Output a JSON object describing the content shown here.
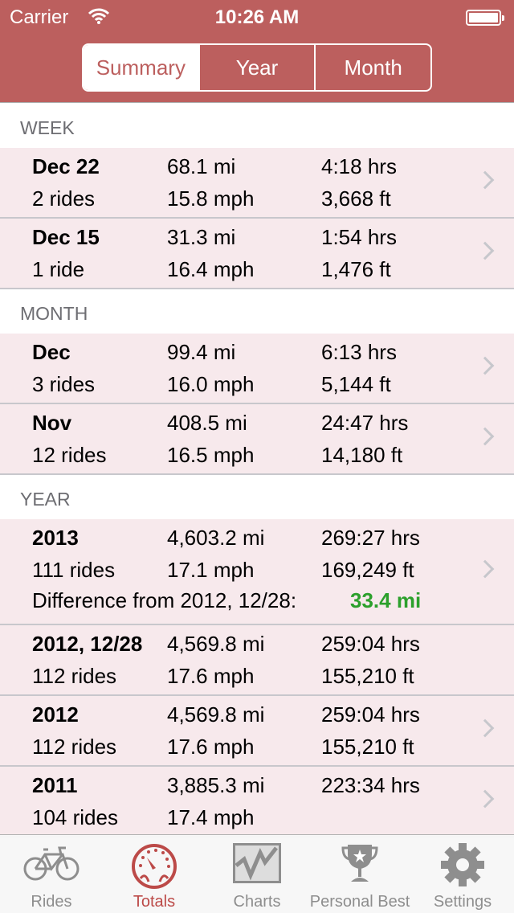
{
  "status": {
    "carrier": "Carrier",
    "time": "10:26 AM"
  },
  "segments": [
    "Summary",
    "Year",
    "Month"
  ],
  "sections": [
    {
      "title": "WEEK",
      "rows": [
        {
          "label": "Dec 22",
          "rides": "2 rides",
          "distance": "68.1 mi",
          "speed": "15.8 mph",
          "time": "4:18 hrs",
          "climb": "3,668 ft"
        },
        {
          "label": "Dec 15",
          "rides": "1 ride",
          "distance": "31.3 mi",
          "speed": "16.4 mph",
          "time": "1:54 hrs",
          "climb": "1,476 ft"
        }
      ]
    },
    {
      "title": "MONTH",
      "rows": [
        {
          "label": "Dec",
          "rides": "3 rides",
          "distance": "99.4 mi",
          "speed": "16.0 mph",
          "time": "6:13 hrs",
          "climb": "5,144 ft"
        },
        {
          "label": "Nov",
          "rides": "12 rides",
          "distance": "408.5 mi",
          "speed": "16.5 mph",
          "time": "24:47 hrs",
          "climb": "14,180 ft"
        }
      ]
    },
    {
      "title": "YEAR",
      "rows": [
        {
          "label": "2013",
          "rides": "111 rides",
          "distance": "4,603.2 mi",
          "speed": "17.1 mph",
          "time": "269:27 hrs",
          "climb": "169,249 ft",
          "diff_label": "Difference from 2012, 12/28:",
          "diff_value": "33.4 mi"
        },
        {
          "label": "2012, 12/28",
          "rides": "112 rides",
          "distance": "4,569.8 mi",
          "speed": "17.6 mph",
          "time": "259:04 hrs",
          "climb": "155,210 ft"
        },
        {
          "label": "2012",
          "rides": "112 rides",
          "distance": "4,569.8 mi",
          "speed": "17.6 mph",
          "time": "259:04 hrs",
          "climb": "155,210 ft"
        },
        {
          "label": "2011",
          "rides": "104 rides",
          "distance": "3,885.3 mi",
          "speed": "17.4 mph",
          "time": "223:34 hrs",
          "climb": ""
        }
      ]
    }
  ],
  "tabs": [
    {
      "label": "Rides",
      "icon": "bicycle-icon"
    },
    {
      "label": "Totals",
      "icon": "speedometer-icon",
      "active": true
    },
    {
      "label": "Charts",
      "icon": "chart-icon"
    },
    {
      "label": "Personal Best",
      "icon": "trophy-icon"
    },
    {
      "label": "Settings",
      "icon": "gear-icon"
    }
  ],
  "colors": {
    "accent": "#bc5f5e",
    "row_bg": "#f7e9ec",
    "positive": "#2ca02c"
  }
}
